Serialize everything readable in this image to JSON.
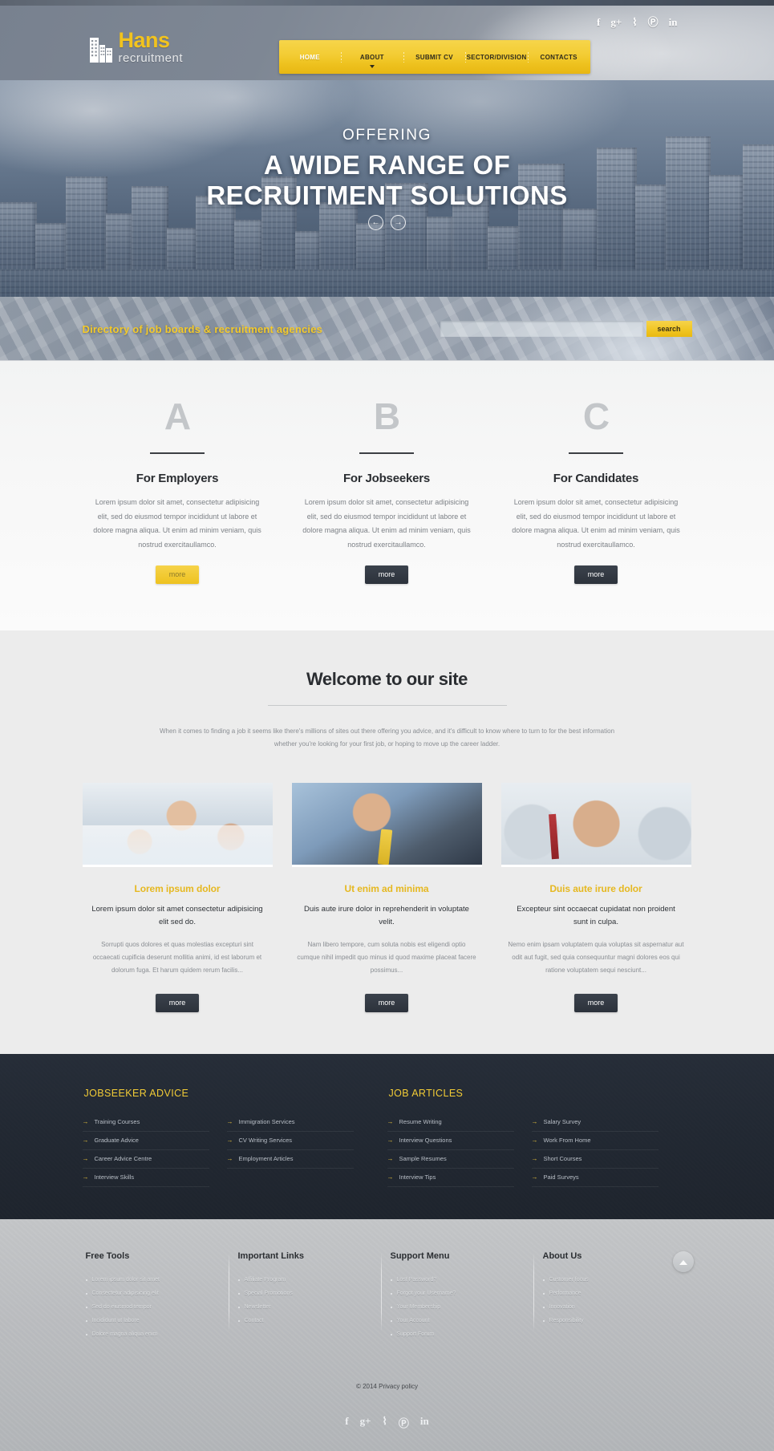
{
  "header": {
    "logo_name": "Hans",
    "logo_sub": "recruitment",
    "social": [
      {
        "name": "facebook-icon",
        "glyph": "f"
      },
      {
        "name": "google-plus-icon",
        "glyph": "g+"
      },
      {
        "name": "rss-icon",
        "glyph": "⌇"
      },
      {
        "name": "pinterest-icon",
        "glyph": "Ⓟ"
      },
      {
        "name": "linkedin-icon",
        "glyph": "in"
      }
    ],
    "nav": [
      {
        "label": "HOME",
        "active": true,
        "caret": false
      },
      {
        "label": "ABOUT",
        "active": false,
        "caret": true
      },
      {
        "label": "SUBMIT CV",
        "active": false,
        "caret": false
      },
      {
        "label": "SECTOR/DIVISION",
        "active": false,
        "caret": false
      },
      {
        "label": "CONTACTS",
        "active": false,
        "caret": false
      }
    ]
  },
  "hero": {
    "line1": "OFFERING",
    "line2": "A WIDE RANGE OF",
    "line3": "RECRUITMENT SOLUTIONS",
    "prev": "←",
    "next": "→"
  },
  "search": {
    "title": "Directory of job boards & recruitment agencies",
    "value": "",
    "placeholder": "",
    "button": "search"
  },
  "abc": {
    "columns": [
      {
        "letter": "A",
        "heading": "For Employers",
        "text": "Lorem ipsum dolor sit amet, consectetur adipisicing elit, sed do eiusmod tempor incididunt ut labore et dolore magna aliqua. Ut enim ad minim veniam, quis nostrud exercitaullamco.",
        "button": "more",
        "button_style": "yellow"
      },
      {
        "letter": "B",
        "heading": "For Jobseekers",
        "text": "Lorem ipsum dolor sit amet, consectetur adipisicing elit, sed do eiusmod tempor incididunt ut labore et dolore magna aliqua. Ut enim ad minim veniam, quis nostrud exercitaullamco.",
        "button": "more",
        "button_style": "dark"
      },
      {
        "letter": "C",
        "heading": "For Candidates",
        "text": "Lorem ipsum dolor sit amet, consectetur adipisicing elit, sed do eiusmod tempor incididunt ut labore et dolore magna aliqua. Ut enim ad minim veniam, quis nostrud exercitaullamco.",
        "button": "more",
        "button_style": "dark"
      }
    ]
  },
  "welcome": {
    "heading": "Welcome to our site",
    "intro_line1": "When it comes to finding a job it seems like there's millions of sites out there offering you advice, and it's difficult to know where to turn to for the best information",
    "intro_line2": "whether you're looking for your first job, or hoping to move up the career ladder.",
    "cards": [
      {
        "image": "photo-three-businesspeople",
        "heading": "Lorem ipsum dolor",
        "lead": "Lorem ipsum dolor sit amet consectetur adipisicing elit sed do.",
        "body": "Sorrupti quos dolores et quas molestias excepturi sint occaecati cupificia deserunt mollitia animi, id est laborum et dolorum fuga. Et harum quidem rerum facilis...",
        "button": "more"
      },
      {
        "image": "photo-businessman-on-phone",
        "heading": "Ut enim ad minima",
        "lead": "Duis aute irure dolor in reprehenderit in voluptate velit.",
        "body": "Nam libero tempore, cum soluta nobis est eligendi optio cumque nihil impedit quo minus id quod maxime placeat facere possimus...",
        "button": "more"
      },
      {
        "image": "photo-smiling-man-portrait",
        "heading": "Duis aute irure dolor",
        "lead": "Excepteur sint occaecat cupidatat non proident sunt in culpa.",
        "body": "Nemo enim ipsam voluptatem quia voluptas sit aspernatur aut odit aut fugit, sed quia consequuntur magni dolores eos qui ratione voluptatem sequi nesciunt...",
        "button": "more"
      }
    ]
  },
  "dark_footer": {
    "groups": [
      {
        "heading": "JOBSEEKER ADVICE",
        "columns": [
          [
            "Training Courses",
            "Graduate Advice",
            "Career Advice Centre",
            "Interview Skills"
          ],
          [
            "Immigration Services",
            "CV Writing Services",
            "Employment Articles"
          ]
        ]
      },
      {
        "heading": "JOB ARTICLES",
        "columns": [
          [
            "Resume Writing",
            "Interview Questions",
            "Sample Resumes",
            "Interview Tips"
          ],
          [
            "Salary Survey",
            "Work From Home",
            "Short Courses",
            "Paid Surveys"
          ]
        ]
      }
    ],
    "arrow": "→"
  },
  "bottom_footer": {
    "columns": [
      {
        "heading": "Free Tools",
        "links": [
          "Lorem ipsum dolor sit amet",
          "Consectetur adipisicing elit",
          "Sed do eiusmod tempor",
          "Incididunt ut labore",
          "Dolore magna aliqua enim"
        ]
      },
      {
        "heading": "Important Links",
        "links": [
          "Affiliate Program",
          "Special Promotions",
          "Newsletter",
          "Contact"
        ]
      },
      {
        "heading": "Support Menu",
        "links": [
          "Lost Password?",
          "Forgot your Username?",
          "Your Membership",
          "Your Account",
          "Support Forum"
        ]
      },
      {
        "heading": "About Us",
        "links": [
          "Customer focus",
          "Performance",
          "Innovation",
          "Responsibility"
        ]
      }
    ],
    "scroll_top": "scroll-to-top",
    "copyright": "© 2014 Privacy policy",
    "social": [
      {
        "name": "facebook-icon",
        "glyph": "f"
      },
      {
        "name": "google-plus-icon",
        "glyph": "g+"
      },
      {
        "name": "rss-icon",
        "glyph": "⌇"
      },
      {
        "name": "pinterest-icon",
        "glyph": "Ⓟ"
      },
      {
        "name": "linkedin-icon",
        "glyph": "in"
      }
    ]
  },
  "colors": {
    "accent_yellow": "#f2c31e",
    "dark_panel": "#222933",
    "hero_blue": "#5b6d82",
    "text_dark": "#2a2d31",
    "text_muted": "#8a8e93"
  }
}
